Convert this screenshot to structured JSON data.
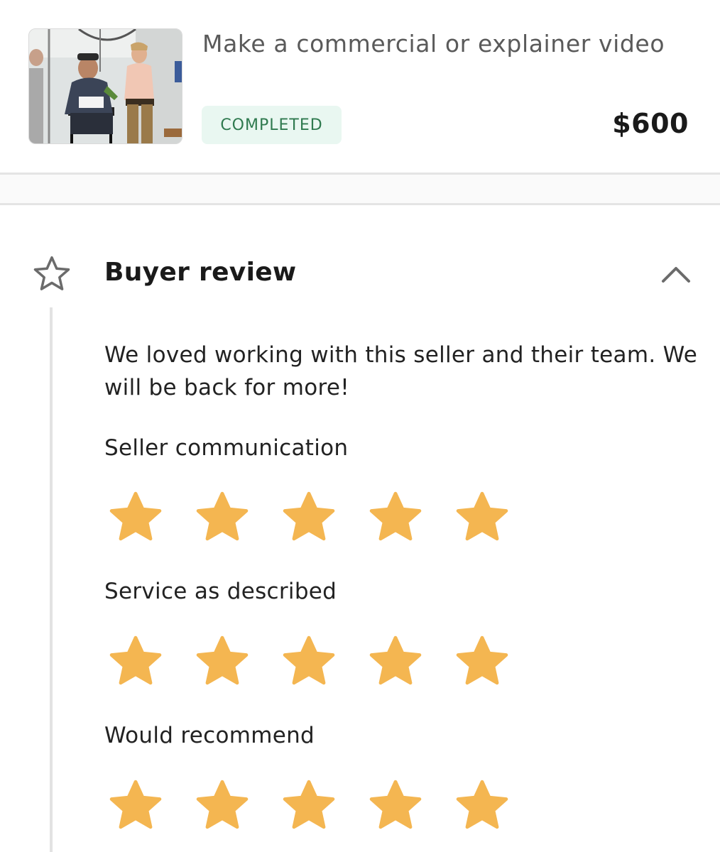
{
  "order": {
    "title": "Make a commercial or explainer video",
    "status": "COMPLETED",
    "price": "$600"
  },
  "review": {
    "heading": "Buyer review",
    "text": "We loved working with this seller and their team. We will be back for more!",
    "ratings": [
      {
        "label": "Seller communication",
        "stars": 5,
        "max": 5
      },
      {
        "label": "Service as described",
        "stars": 5,
        "max": 5
      },
      {
        "label": "Would recommend",
        "stars": 5,
        "max": 5
      }
    ]
  },
  "colors": {
    "star_fill": "#f4b651",
    "status_bg": "#e9f7f1",
    "status_text": "#2f7a4f",
    "icon_gray": "#6b6b6b"
  },
  "icons": {
    "section": "star-outline-icon",
    "toggle": "chevron-up-icon",
    "rating": "star-filled-icon"
  }
}
